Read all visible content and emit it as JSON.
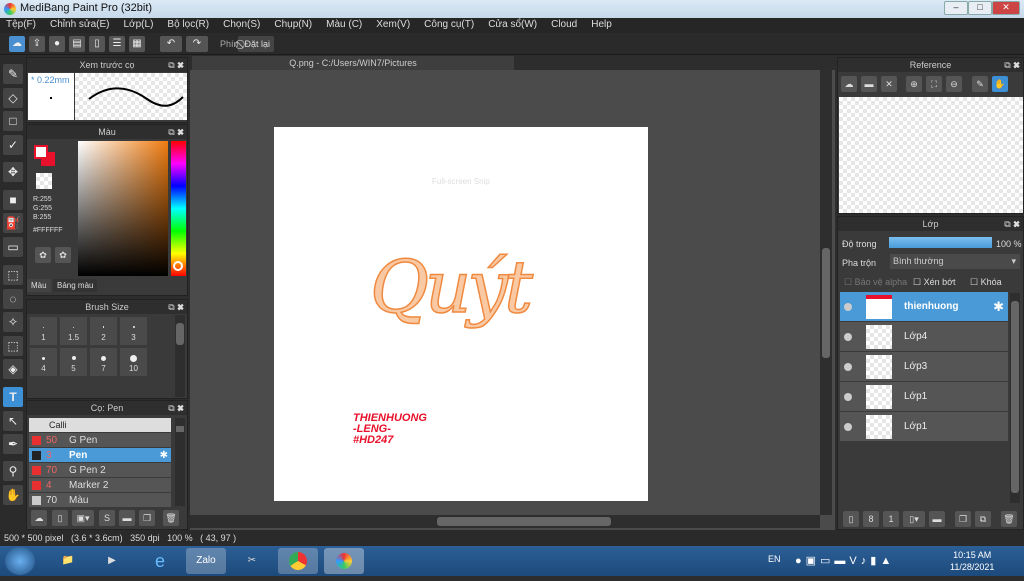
{
  "app": {
    "title": "MediBang Paint Pro (32bit)",
    "window_controls": [
      "–",
      "□",
      "✕"
    ]
  },
  "menu": [
    "Tệp(F)",
    "Chỉnh sửa(E)",
    "Lớp(L)",
    "Bộ lọc(R)",
    "Chọn(S)",
    "Chụp(N)",
    "Màu (C)",
    "Xem(V)",
    "Công cụ(T)",
    "Cửa sổ(W)",
    "Cloud",
    "Help"
  ],
  "toolbar": {
    "shortcut_label": "Phím",
    "reset_label": "Đặt lại"
  },
  "brush_preview": {
    "title": "Xem trước cọ",
    "size": "* 0.22mm"
  },
  "color_panel": {
    "title": "Màu",
    "r": "R:255",
    "g": "G:255",
    "b": "B:255",
    "hex": "#FFFFFF",
    "tabs": [
      "Màu",
      "Bảng màu"
    ],
    "fg": "#ffffff",
    "bg": "#e8102a"
  },
  "brush_size": {
    "title": "Brush Size",
    "sizes": [
      "1",
      "1.5",
      "2",
      "3",
      "4",
      "5",
      "7",
      "10"
    ]
  },
  "brush_list": {
    "title": "Cọ: Pen",
    "group": "Calli",
    "items": [
      {
        "size": "50",
        "name": "G Pen",
        "color": "#e83030"
      },
      {
        "size": "3",
        "name": "Pen",
        "color": "#222222",
        "selected": true
      },
      {
        "size": "70",
        "name": "G Pen 2",
        "color": "#e83030"
      },
      {
        "size": "4",
        "name": "Marker 2",
        "color": "#e83030"
      },
      {
        "size": "70",
        "name": "Màu",
        "color": "#cccccc"
      }
    ]
  },
  "canvas": {
    "tab": "Q.png - C:/Users/WIN7/Pictures",
    "snip_text": "Full-screen Snip",
    "art_word": "Quýt",
    "signature": [
      "THIENHUONG",
      "-LENG-",
      "#HD247"
    ]
  },
  "reference": {
    "title": "Reference"
  },
  "layers": {
    "title": "Lớp",
    "opacity_label": "Độ trong",
    "opacity_value": "100 %",
    "opacity": 100,
    "blend_label": "Pha trộn",
    "blend_value": "Bình thường",
    "checks": [
      "Bảo vệ alpha",
      "Xén bớt",
      "Khóa"
    ],
    "items": [
      {
        "name": "thienhuong",
        "selected": true
      },
      {
        "name": "Lớp4"
      },
      {
        "name": "Lớp3"
      },
      {
        "name": "Lớp1"
      },
      {
        "name": "Lớp1"
      }
    ]
  },
  "status": "500 * 500 pixel   (3.6 * 3.6cm)   350 dpi   100 %   ( 43, 97 )",
  "taskbar": {
    "lang": "EN",
    "time": "10:15 AM",
    "date": "11/28/2021",
    "apps": [
      "explorer",
      "media-player",
      "internet-explorer",
      "Zalo",
      "snipping-tool",
      "chrome",
      "medibang"
    ]
  },
  "colors": {
    "accent": "#4a9ad8",
    "signature": "#e8102a",
    "art": "#f08a40"
  }
}
